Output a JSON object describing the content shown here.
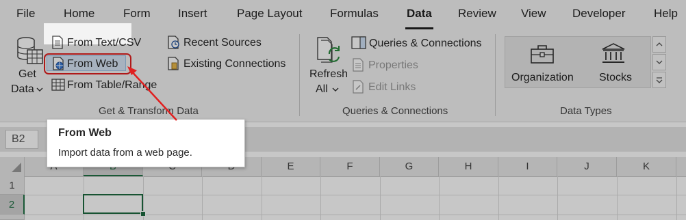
{
  "menu": {
    "tabs": [
      {
        "label": "File"
      },
      {
        "label": "Home"
      },
      {
        "label": "Form"
      },
      {
        "label": "Insert"
      },
      {
        "label": "Page Layout"
      },
      {
        "label": "Formulas"
      },
      {
        "label": "Data",
        "active": true
      },
      {
        "label": "Review"
      },
      {
        "label": "View"
      },
      {
        "label": "Developer"
      },
      {
        "label": "Help"
      }
    ]
  },
  "ribbon": {
    "get_transform": {
      "get_data_line1": "Get",
      "get_data_line2": "Data",
      "from_text_csv": "From Text/CSV",
      "from_web": "From Web",
      "from_table_range": "From Table/Range",
      "recent_sources": "Recent Sources",
      "existing_connections": "Existing Connections",
      "group_label": "Get & Transform Data"
    },
    "queries": {
      "refresh_line1": "Refresh",
      "refresh_line2": "All",
      "queries_connections": "Queries & Connections",
      "properties": "Properties",
      "edit_links": "Edit Links",
      "group_label": "Queries & Connections"
    },
    "data_types": {
      "organization": "Organization",
      "stocks": "Stocks",
      "group_label": "Data Types"
    }
  },
  "name_box": "B2",
  "tooltip": {
    "title": "From Web",
    "description": "Import data from a web page."
  },
  "grid": {
    "columns": [
      "A",
      "B",
      "C",
      "D",
      "E",
      "F",
      "G",
      "H",
      "I",
      "J",
      "K"
    ],
    "rows": [
      "1",
      "2"
    ],
    "selected_column": "B",
    "selected_row": "2"
  },
  "colors": {
    "accent_green": "#217346",
    "highlight_red": "#e02020"
  }
}
